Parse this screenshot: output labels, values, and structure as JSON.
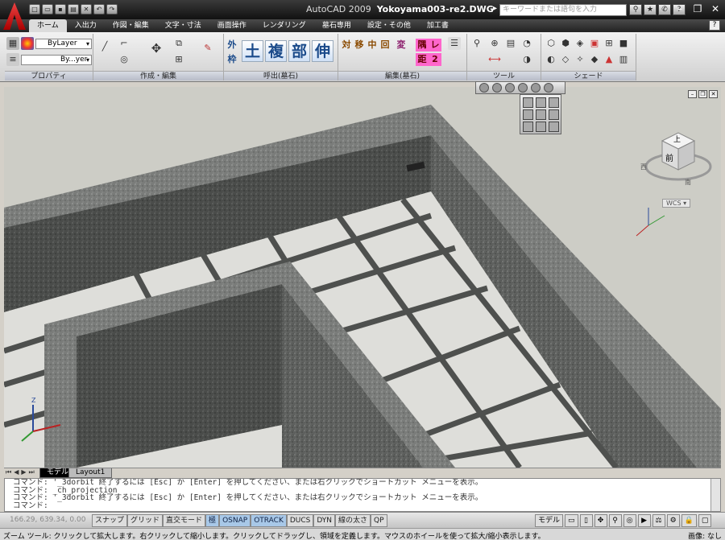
{
  "app": {
    "name": "AutoCAD 2009",
    "file": "Yokoyama003-re2.DWG",
    "search_placeholder": "キーワードまたは語句を入力"
  },
  "tabs": [
    {
      "label": "ホーム"
    },
    {
      "label": "入出力"
    },
    {
      "label": "作図・編集"
    },
    {
      "label": "文字・寸法"
    },
    {
      "label": "画面操作"
    },
    {
      "label": "レンダリング"
    },
    {
      "label": "墓石専用"
    },
    {
      "label": "設定・その他"
    },
    {
      "label": "加工書"
    }
  ],
  "ribbon": {
    "panels": [
      {
        "title": "プロパティ"
      },
      {
        "title": "作成・編集"
      },
      {
        "title": "呼出(墓石)"
      },
      {
        "title": "編集(墓石)"
      },
      {
        "title": "ツール"
      },
      {
        "title": "シェード"
      }
    ],
    "layer_select": "ByLayer",
    "linetype_select": "By...yer",
    "kanji_small_left": [
      "外",
      "枠"
    ],
    "kanji_big": [
      "土",
      "複",
      "部",
      "伸"
    ],
    "edit_kanji": [
      "対",
      "移",
      "中",
      "回",
      "変"
    ],
    "edit_kanji2": [
      "隅",
      "レ",
      "距",
      "2"
    ]
  },
  "viewcube": {
    "top": "上",
    "front": "前",
    "west": "西",
    "south": "南",
    "wcs": "WCS"
  },
  "layout_tabs": [
    {
      "label": "モデル"
    },
    {
      "label": "Layout1"
    }
  ],
  "command_lines": [
    "コマンド: '_3dorbit 終了するには [Esc] か [Enter] を押してください、または右クリックでショートカット メニューを表示。",
    "コマンド: _ch_projection",
    "コマンド: '_3dorbit 終了するには [Esc] か [Enter] を押してください、または右クリックでショートカット メニューを表示。",
    "コマンド:"
  ],
  "status": {
    "coords": "166.29, 639.34, 0.00",
    "toggles": [
      {
        "label": "スナップ",
        "on": false
      },
      {
        "label": "グリッド",
        "on": false
      },
      {
        "label": "直交モード",
        "on": false
      },
      {
        "label": "極",
        "on": true
      },
      {
        "label": "OSNAP",
        "on": true
      },
      {
        "label": "OTRACK",
        "on": true
      },
      {
        "label": "DUCS",
        "on": false
      },
      {
        "label": "DYN",
        "on": false
      },
      {
        "label": "線の太さ",
        "on": false
      },
      {
        "label": "QP",
        "on": false
      }
    ],
    "model_label": "モデル"
  },
  "bottom": {
    "message": "ズーム ツール: クリックして拡大します。右クリックして縮小します。クリックしてドラッグし、領域を定義します。マウスのホイールを使って拡大/縮小表示します。",
    "right": "画像: なし"
  }
}
